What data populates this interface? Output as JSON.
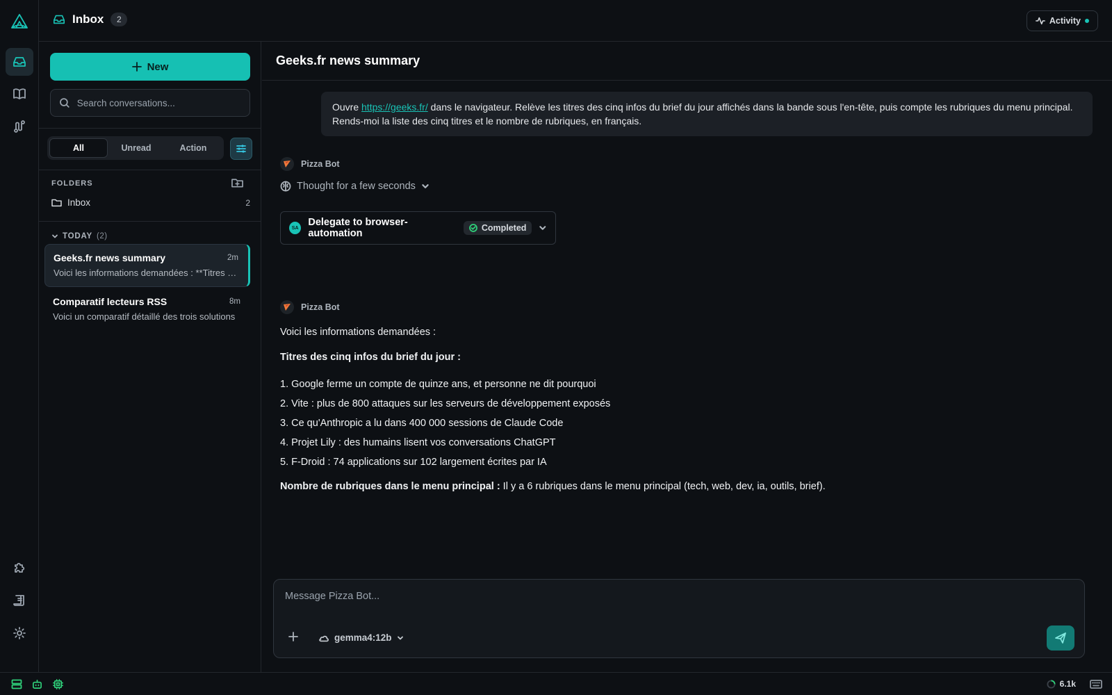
{
  "header": {
    "title": "Inbox",
    "count": "2",
    "activity_label": "Activity"
  },
  "sidebar": {
    "new_label": "New",
    "search_placeholder": "Search conversations...",
    "tabs": [
      {
        "label": "All",
        "active": true
      },
      {
        "label": "Unread",
        "active": false
      },
      {
        "label": "Action",
        "active": false
      }
    ],
    "folders_heading": "FOLDERS",
    "folders": [
      {
        "label": "Inbox",
        "count": "2"
      }
    ],
    "today_heading": "TODAY",
    "today_count": "(2)",
    "conversations": [
      {
        "title": "Geeks.fr news summary",
        "time": "2m",
        "preview": "Voici les informations demandées : **Titres des cinq infos du brief du jour :**",
        "active": true
      },
      {
        "title": "Comparatif lecteurs RSS",
        "time": "8m",
        "preview": "Voici un comparatif détaillé des trois solutions",
        "active": false
      }
    ]
  },
  "chat": {
    "title": "Geeks.fr news summary",
    "user_message": {
      "prefix": "Ouvre ",
      "link": "https://geeks.fr/",
      "suffix": " dans le navigateur. Relève les titres des cinq infos du brief du jour affichés dans la bande sous l'en-tête, puis compte les rubriques du menu principal. Rends-moi la liste des cinq titres et le nombre de rubriques, en français."
    },
    "bot_name": "Pizza Bot",
    "thought_label": "Thought for a few seconds",
    "delegate": {
      "avatar_text": "SA",
      "label": "Delegate to browser-automation",
      "status": "Completed"
    },
    "answer": {
      "intro": "Voici les informations demandées :",
      "heading": "Titres des cinq infos du brief du jour :",
      "items": [
        "1. Google ferme un compte de quinze ans, et personne ne dit pourquoi",
        "2. Vite : plus de 800 attaques sur les serveurs de développement exposés",
        "3. Ce qu'Anthropic a lu dans 400 000 sessions de Claude Code",
        "4. Projet Lily : des humains lisent vos conversations ChatGPT",
        "5. F-Droid : 74 applications sur 102 largement écrites par IA"
      ],
      "count_label": "Nombre de rubriques dans le menu principal :",
      "count_text": " Il y a 6 rubriques dans le menu principal (tech, web, dev, ia, outils, brief)."
    },
    "composer": {
      "placeholder": "Message Pizza Bot...",
      "model": "gemma4:12b"
    }
  },
  "status_bar": {
    "tokens": "6.1k"
  },
  "colors": {
    "accent": "#19c3b6",
    "background": "#0d1014",
    "status_green": "#2fd07a"
  }
}
